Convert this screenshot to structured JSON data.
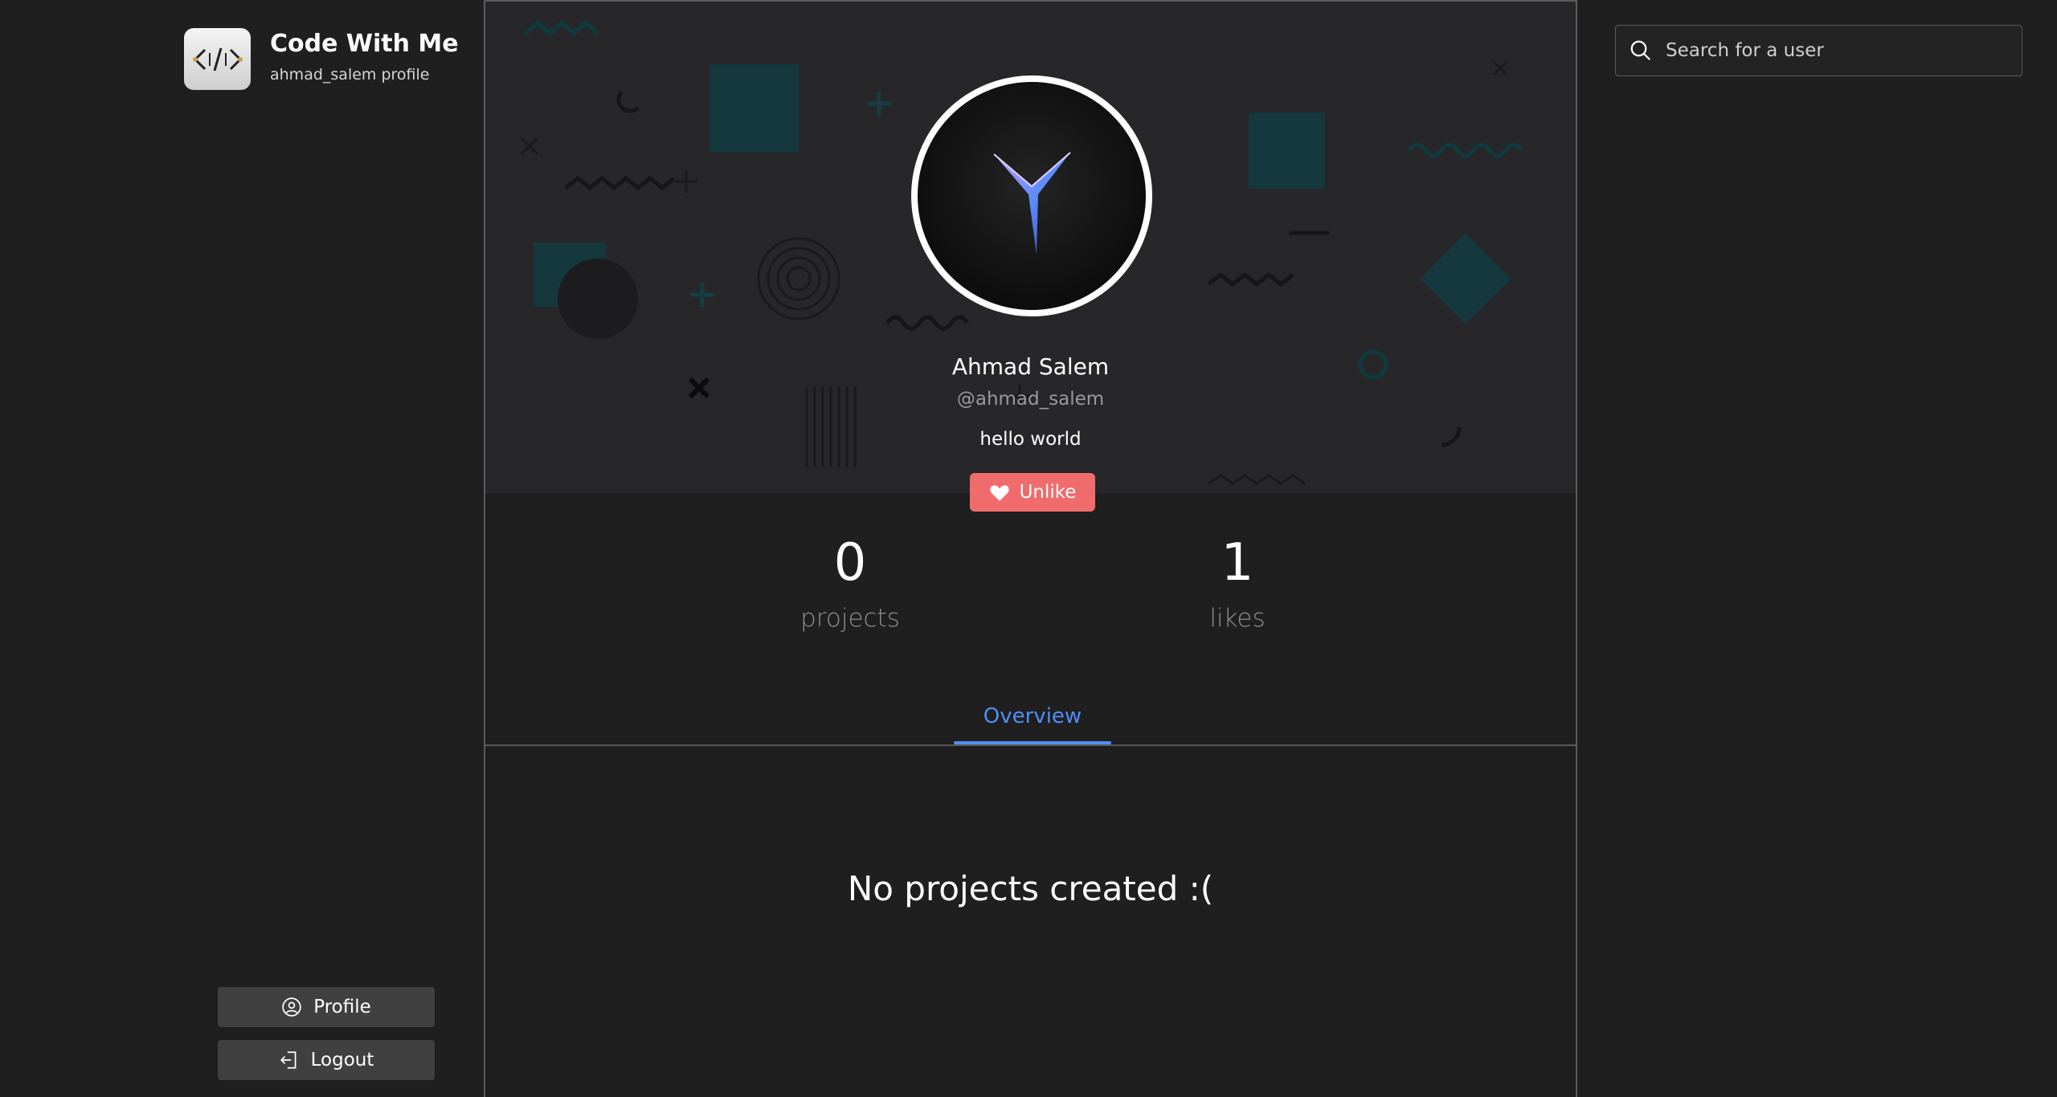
{
  "brand": {
    "title": "Code With Me",
    "subtitle": "ahmad_salem profile"
  },
  "sidebar": {
    "profile_label": "Profile",
    "logout_label": "Logout"
  },
  "profile": {
    "name": "Ahmad Salem",
    "handle": "@ahmad_salem",
    "bio": "hello world",
    "unlike_label": "Unlike",
    "stats": {
      "projects_count": "0",
      "projects_label": "projects",
      "likes_count": "1",
      "likes_label": "likes"
    },
    "tab_overview": "Overview",
    "empty_message": "No projects created :("
  },
  "search": {
    "placeholder": "Search for a user"
  },
  "colors": {
    "accent": "#4f8ff7",
    "unlike": "#f06c6c",
    "background": "#1f1f1f",
    "banner": "#27272a"
  }
}
